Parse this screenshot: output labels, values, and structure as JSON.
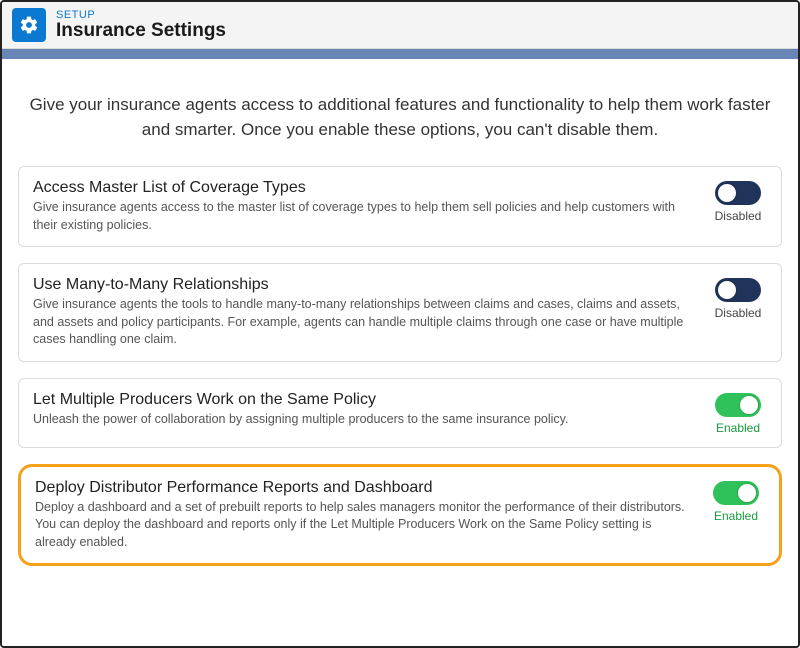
{
  "header": {
    "breadcrumb": "SETUP",
    "title": "Insurance Settings"
  },
  "intro": "Give your insurance agents access to additional features and functionality to help them work faster and smarter. Once you enable these options, you can't disable them.",
  "labels": {
    "enabled": "Enabled",
    "disabled": "Disabled"
  },
  "settings": [
    {
      "id": "access-master-list",
      "title": "Access Master List of Coverage Types",
      "description": "Give insurance agents access to the master list of coverage types to help them sell policies and help customers with their existing policies.",
      "enabled": false,
      "highlighted": false
    },
    {
      "id": "many-to-many",
      "title": "Use Many-to-Many Relationships",
      "description": "Give insurance agents the tools to handle many-to-many relationships between claims and cases, claims and assets, and assets and policy participants. For example, agents can handle multiple claims through one case or have multiple cases handling one claim.",
      "enabled": false,
      "highlighted": false
    },
    {
      "id": "multiple-producers",
      "title": "Let Multiple Producers Work on the Same Policy",
      "description": "Unleash the power of collaboration by assigning multiple producers to the same insurance policy.",
      "enabled": true,
      "highlighted": false
    },
    {
      "id": "distributor-reports",
      "title": "Deploy Distributor Performance Reports and Dashboard",
      "description": "Deploy a dashboard and a set of prebuilt reports to help sales managers monitor the performance of their distributors. You can deploy the dashboard and reports only if the Let Multiple Producers Work on the Same Policy setting is already enabled.",
      "enabled": true,
      "highlighted": true
    }
  ]
}
